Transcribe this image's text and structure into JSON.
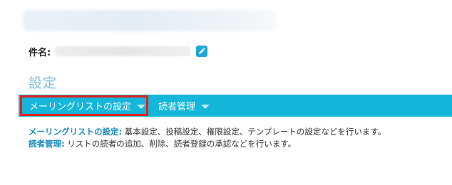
{
  "header": {
    "blurred_title": ""
  },
  "subject": {
    "label": "件名:",
    "value": ""
  },
  "section": {
    "title": "設定"
  },
  "tabs": [
    {
      "label": "メーリングリストの設定",
      "highlighted": true
    },
    {
      "label": "読者管理",
      "highlighted": false
    }
  ],
  "descriptions": [
    {
      "key": "メーリングリストの設定:",
      "text": " 基本設定、投稿設定、権限設定、テンプレートの設定などを行います。"
    },
    {
      "key": "読者管理:",
      "text": " リストの読者の追加、削除、読者登録の承認などを行います。"
    }
  ],
  "colors": {
    "tab_bar": "#14b6d9",
    "highlight_border": "#e3201b",
    "section_title": "#7fc0dc",
    "desc_key": "#1a8bbf",
    "edit_button": "#1fa8d8"
  },
  "icons": {
    "edit": "pencil-icon",
    "dropdown": "caret-down-icon"
  }
}
